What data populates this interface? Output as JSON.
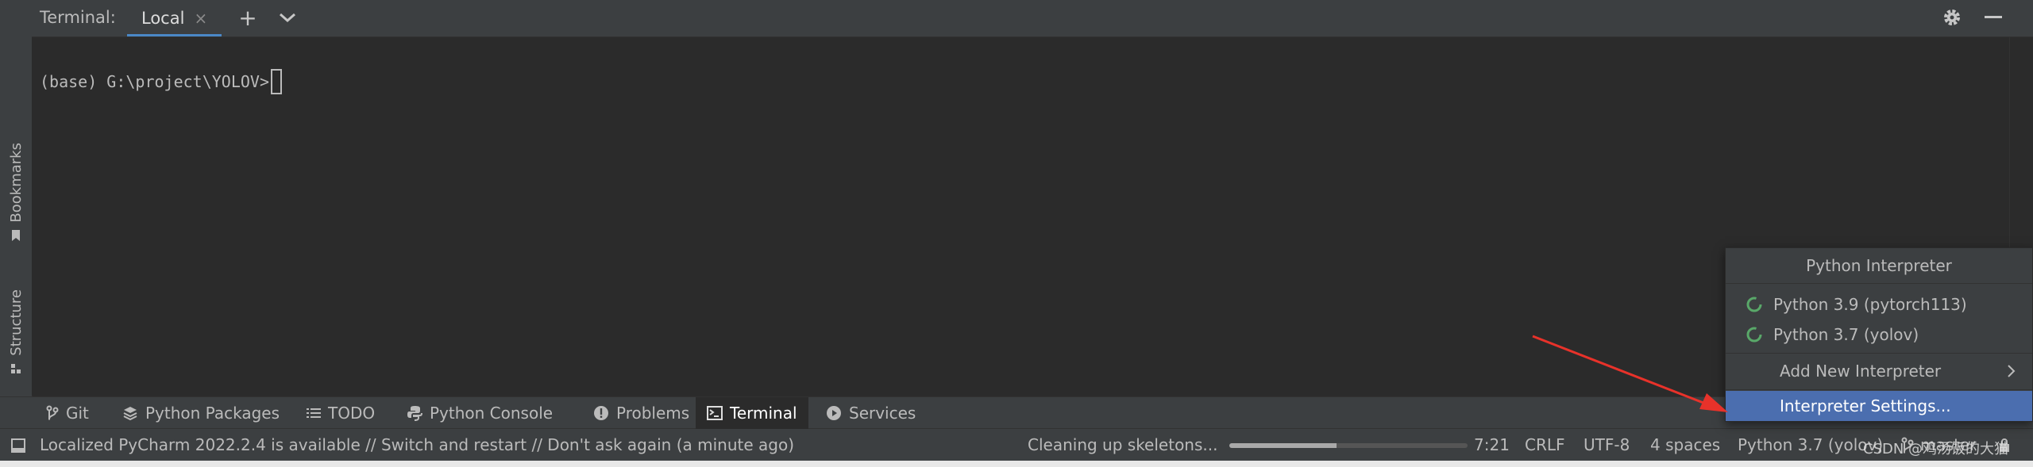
{
  "left_strip": {
    "bookmarks": "Bookmarks",
    "structure": "Structure"
  },
  "terminal": {
    "title": "Terminal:",
    "tab_local": "Local",
    "tab_close": "×",
    "add_tab": "+",
    "chevron": "⌄",
    "prompt": "(base) G:\\project\\YOLOV>"
  },
  "tool_windows": {
    "git": "Git",
    "python_packages": "Python Packages",
    "todo": "TODO",
    "python_console": "Python Console",
    "problems": "Problems",
    "terminal": "Terminal",
    "services": "Services"
  },
  "status": {
    "message": "Localized PyCharm 2022.2.4 is available // Switch and restart // Don't ask again (a minute ago)",
    "task": "Cleaning up skeletons...",
    "progress": 0.45,
    "position": "7:21",
    "line_sep": "CRLF",
    "encoding": "UTF-8",
    "indent": "4 spaces",
    "interpreter": "Python 3.7 (yolov)",
    "branch": "master"
  },
  "popup": {
    "title": "Python Interpreter",
    "interpreters": [
      "Python 3.9 (pytorch113)",
      "Python 3.7 (yolov)"
    ],
    "add_new": "Add New Interpreter",
    "settings": "Interpreter Settings..."
  },
  "watermark": "CSDN @鸡汤饭的大猫",
  "colors": {
    "accent_blue": "#4b6eaf",
    "spinner_green": "#59a869",
    "arrow_red": "#e8322a"
  }
}
